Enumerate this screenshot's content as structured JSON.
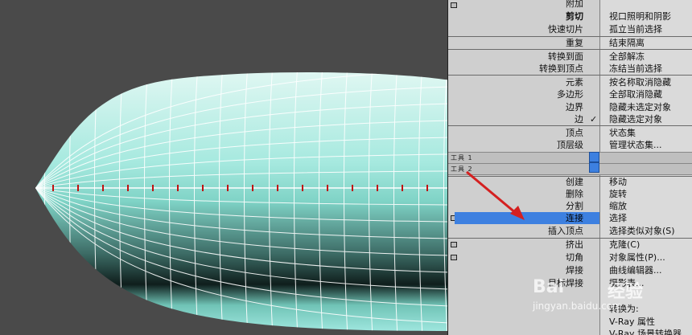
{
  "quad_menu": {
    "left_items": [
      {
        "id": "attach",
        "label": "附加"
      },
      {
        "id": "cut",
        "label": "剪切"
      },
      {
        "id": "quickslice",
        "label": "快速切片"
      },
      {
        "id": "repeat",
        "label": "重复"
      },
      {
        "id": "toface",
        "label": "转换到面"
      },
      {
        "id": "tovertex",
        "label": "转换到顶点"
      },
      {
        "id": "element",
        "label": "元素"
      },
      {
        "id": "polygon",
        "label": "多边形"
      },
      {
        "id": "border",
        "label": "边界"
      },
      {
        "id": "edge",
        "label": "边"
      },
      {
        "id": "vertex",
        "label": "顶点"
      },
      {
        "id": "toplevel",
        "label": "顶层级"
      },
      {
        "id": "create",
        "label": "创建"
      },
      {
        "id": "remove",
        "label": "删除"
      },
      {
        "id": "divide",
        "label": "分割"
      },
      {
        "id": "connect",
        "label": "连接"
      },
      {
        "id": "insertvertex",
        "label": "插入顶点"
      },
      {
        "id": "extrude",
        "label": "挤出"
      },
      {
        "id": "chamfer",
        "label": "切角"
      },
      {
        "id": "weld",
        "label": "焊接"
      },
      {
        "id": "target_weld",
        "label": "目标焊接"
      }
    ],
    "right_items": [
      {
        "id": "viewport_lighting",
        "label": "视口照明和阴影"
      },
      {
        "id": "isolate",
        "label": "孤立当前选择"
      },
      {
        "id": "end_isolate",
        "label": "结束隔离"
      },
      {
        "id": "unfreeze_all",
        "label": "全部解冻"
      },
      {
        "id": "freeze",
        "label": "冻结当前选择"
      },
      {
        "id": "unhide_by_name",
        "label": "按名称取消隐藏"
      },
      {
        "id": "unhide_all",
        "label": "全部取消隐藏"
      },
      {
        "id": "hide_unselected",
        "label": "隐藏未选定对象"
      },
      {
        "id": "hide_selected",
        "label": "隐藏选定对象"
      },
      {
        "id": "state_sets",
        "label": "状态集"
      },
      {
        "id": "manage_state_sets",
        "label": "管理状态集..."
      },
      {
        "id": "move",
        "label": "移动"
      },
      {
        "id": "rotate",
        "label": "旋转"
      },
      {
        "id": "scale",
        "label": "缩放"
      },
      {
        "id": "select",
        "label": "选择"
      },
      {
        "id": "select_similar",
        "label": "选择类似对象(S)"
      },
      {
        "id": "clone",
        "label": "克隆(C)"
      },
      {
        "id": "object_props",
        "label": "对象属性(P)..."
      },
      {
        "id": "curve_editor",
        "label": "曲线编辑器..."
      },
      {
        "id": "dope_sheet",
        "label": "摄影表..."
      },
      {
        "id": "convert_to",
        "label": "转换为:"
      },
      {
        "id": "vray_props",
        "label": "V-Ray 属性"
      },
      {
        "id": "vray_scene_converter",
        "label": "V-Ray 场景转换器"
      }
    ],
    "toolbars": {
      "tools1": "工具 1",
      "tools2": "工具 2"
    },
    "edge_check": "✓"
  },
  "watermark": {
    "brand": "Bai",
    "brand_cn": "经验",
    "url": "jingyan.baidu.com"
  },
  "colors": {
    "highlight": "#3d80e0",
    "mesh": "#9ee6de",
    "wire": "#ffffff",
    "arrow": "#d42020"
  }
}
